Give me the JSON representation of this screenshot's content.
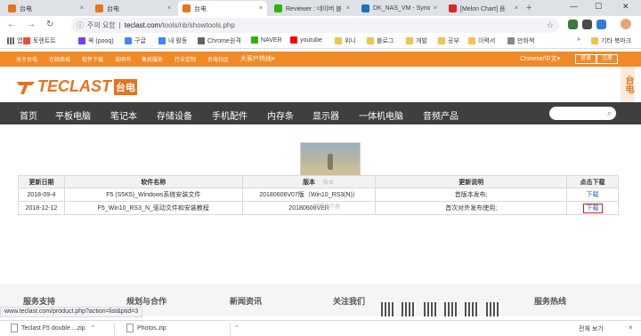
{
  "browser": {
    "tabs": [
      {
        "label": "台电",
        "active": false,
        "favicon_color": "#e8731c"
      },
      {
        "label": "台电",
        "active": false,
        "favicon_color": "#e8731c"
      },
      {
        "label": "台电",
        "active": true,
        "favicon_color": "#e8731c"
      },
      {
        "label": "Reviewer : 네이버 블",
        "active": false,
        "favicon_color": "#2db400"
      },
      {
        "label": "DK_NAS_VM - Synol",
        "active": false,
        "favicon_color": "#1f6fbf"
      },
      {
        "label": "[Melon Chart] 음",
        "active": false,
        "favicon_color": "#e02424"
      }
    ],
    "tab_close_glyph": "×",
    "new_tab_glyph": "+",
    "window_controls": {
      "minimize": "—",
      "maximize": "☐",
      "close": "✕"
    },
    "nav": {
      "back": "←",
      "forward": "→",
      "reload": "↻"
    },
    "address": {
      "security_label": "주의 요함",
      "domain": "teclast.com",
      "path": "/tools/nb/showtools.php"
    },
    "bookmarks": [
      {
        "label": "앱",
        "type": "apps"
      },
      {
        "label": "토렌트트",
        "type": "site",
        "color": "#e84c3d"
      },
      {
        "label": "쏙 (pooq)",
        "type": "site",
        "color": "#7b3fe4"
      },
      {
        "label": "구글",
        "type": "site",
        "color": "#4285f4"
      },
      {
        "label": "내 활동",
        "type": "site",
        "color": "#4285f4"
      },
      {
        "label": "Chrome원격",
        "type": "site",
        "color": "#5f6368"
      },
      {
        "label": "NAVER",
        "type": "site",
        "color": "#2db400"
      },
      {
        "label": "youtube",
        "type": "site",
        "color": "#ff0000"
      },
      {
        "label": "위니",
        "type": "folder"
      },
      {
        "label": "블로그",
        "type": "folder"
      },
      {
        "label": "개발",
        "type": "folder"
      },
      {
        "label": "공부",
        "type": "folder"
      },
      {
        "label": "이력서",
        "type": "folder"
      },
      {
        "label": "만화책",
        "type": "site",
        "color": "#888888"
      },
      {
        "label": "기타 북마크",
        "type": "folder"
      }
    ],
    "status_url": "www.teclast.com/product.php?action=list&ptid=3",
    "downloads": [
      {
        "label": "Teclast F5 double....zip"
      },
      {
        "label": "Photos.zip"
      }
    ],
    "show_all_label": "전체 보기",
    "download_bar_close": "×"
  },
  "site": {
    "top_links": [
      "关于台电",
      "在线商城",
      "软件下载",
      "说明书",
      "售后服务",
      "行业定制",
      "台电社区",
      "大客户热线"
    ],
    "hotline_caret": "▾",
    "language": "Chinese/中文",
    "language_caret": "▾",
    "login": "登录",
    "register": "注册",
    "brand_name": "TECLAST",
    "brand_cn": "台电",
    "side_tab": "台电",
    "nav_items": [
      "首页",
      "平板电脑",
      "笔记本",
      "存储设备",
      "手机配件",
      "内存条",
      "显示器",
      "一体机电脑",
      "音频产品"
    ],
    "search_icon": "search-icon",
    "search_glyph": "⌕",
    "popup_watermark_top": "版本",
    "popup_watermark_bottom": "网络显示器",
    "table": {
      "headers": [
        "更新日期",
        "软件名称",
        "版本",
        "更新说明",
        "点击下载"
      ],
      "rows": [
        {
          "date": "2018-09-4",
          "name": "F5 (S5K5)_Windows系统安装文件",
          "version": "20180606V07版（Win10_RS3(N)）",
          "note": "首版本发布;",
          "download": "下载"
        },
        {
          "date": "2018-12-12",
          "name": "F5_Win10_RS3_N_驱动文件和安装教程",
          "version": "20180606VER",
          "note": "首次对外发布使用;",
          "download": "下载"
        }
      ]
    },
    "footer_heads": [
      "服务支持",
      "规划与合作",
      "新闻资讯",
      "关注我们",
      "服务热线"
    ]
  }
}
